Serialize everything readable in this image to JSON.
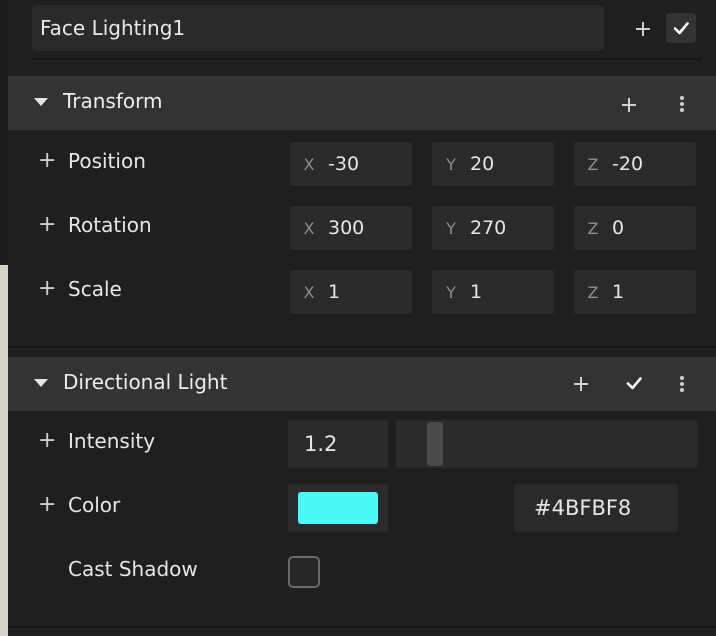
{
  "object": {
    "name": "Face Lighting1"
  },
  "transform": {
    "title": "Transform",
    "rows": [
      {
        "label": "Position",
        "x": "-30",
        "y": "20",
        "z": "-20"
      },
      {
        "label": "Rotation",
        "x": "300",
        "y": "270",
        "z": "0"
      },
      {
        "label": "Scale",
        "x": "1",
        "y": "1",
        "z": "1"
      }
    ],
    "axis_labels": {
      "x": "X",
      "y": "Y",
      "z": "Z"
    }
  },
  "directional_light": {
    "title": "Directional Light",
    "intensity": {
      "label": "Intensity",
      "value": "1.2",
      "slider_fraction": 0.11
    },
    "color": {
      "label": "Color",
      "hex": "#4BFBF8",
      "swatch_color": "#4BFBF8"
    },
    "cast_shadow": {
      "label": "Cast Shadow",
      "checked": false
    }
  },
  "icons": {
    "plus": "+",
    "check": "check-icon",
    "more": "more-vertical-icon",
    "caret": "caret-down-icon"
  },
  "colors": {
    "panel_bg": "#1f1f1f",
    "header_bg": "#333333",
    "field_bg": "#2a2a2a"
  }
}
